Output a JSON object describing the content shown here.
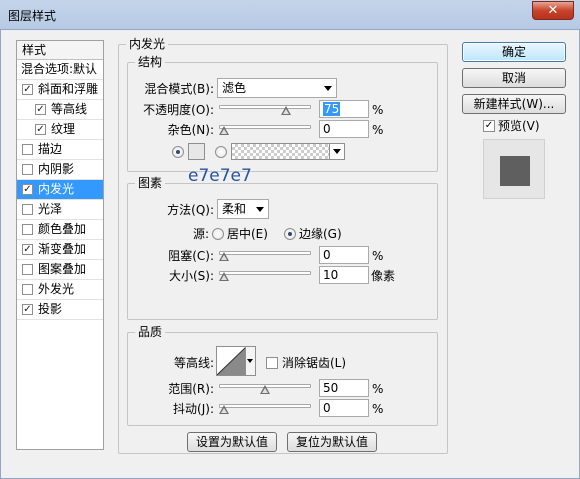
{
  "window": {
    "title": "图层样式",
    "close_label": "✕"
  },
  "style_list": {
    "header": "样式",
    "blend_options": "混合选项:默认",
    "items": [
      {
        "label": "斜面和浮雕",
        "checked": true,
        "sub": false
      },
      {
        "label": "等高线",
        "checked": true,
        "sub": true
      },
      {
        "label": "纹理",
        "checked": true,
        "sub": true
      },
      {
        "label": "描边",
        "checked": false,
        "sub": false
      },
      {
        "label": "内阴影",
        "checked": false,
        "sub": false
      },
      {
        "label": "内发光",
        "checked": true,
        "sub": false,
        "selected": true
      },
      {
        "label": "光泽",
        "checked": false,
        "sub": false
      },
      {
        "label": "颜色叠加",
        "checked": false,
        "sub": false
      },
      {
        "label": "渐变叠加",
        "checked": true,
        "sub": false
      },
      {
        "label": "图案叠加",
        "checked": false,
        "sub": false
      },
      {
        "label": "外发光",
        "checked": false,
        "sub": false
      },
      {
        "label": "投影",
        "checked": true,
        "sub": false
      }
    ]
  },
  "panel": {
    "title": "内发光",
    "structure": {
      "legend": "结构",
      "blend_mode_label": "混合模式(B):",
      "blend_mode_value": "滤色",
      "opacity_label": "不透明度(O):",
      "opacity_value": "75",
      "opacity_percent": 0.75,
      "noise_label": "杂色(N):",
      "noise_value": "0",
      "noise_percent": 0,
      "percent_sign": "%"
    },
    "elements": {
      "legend": "图素",
      "method_label": "方法(Q):",
      "method_value": "柔和",
      "source_label": "源:",
      "source_center": "居中(E)",
      "source_edge": "边缘(G)",
      "choke_label": "阻塞(C):",
      "choke_value": "0",
      "size_label": "大小(S):",
      "size_value": "10",
      "size_unit": "像素"
    },
    "quality": {
      "legend": "品质",
      "contour_label": "等高线:",
      "anti_alias_label": "消除锯齿(L)",
      "range_label": "范围(R):",
      "range_value": "50",
      "range_percent": 0.5,
      "jitter_label": "抖动(J):",
      "jitter_value": "0",
      "jitter_percent": 0
    },
    "set_default": "设置为默认值",
    "reset_default": "复位为默认值"
  },
  "annotation": "e7e7e7",
  "colors": {
    "glow_color": "#e7e7e7",
    "selection": "#3399ff",
    "preview_swatch": "#5f5f5f"
  },
  "buttons": {
    "ok": "确定",
    "cancel": "取消",
    "new_style": "新建样式(W)...",
    "preview": "预览(V)"
  }
}
